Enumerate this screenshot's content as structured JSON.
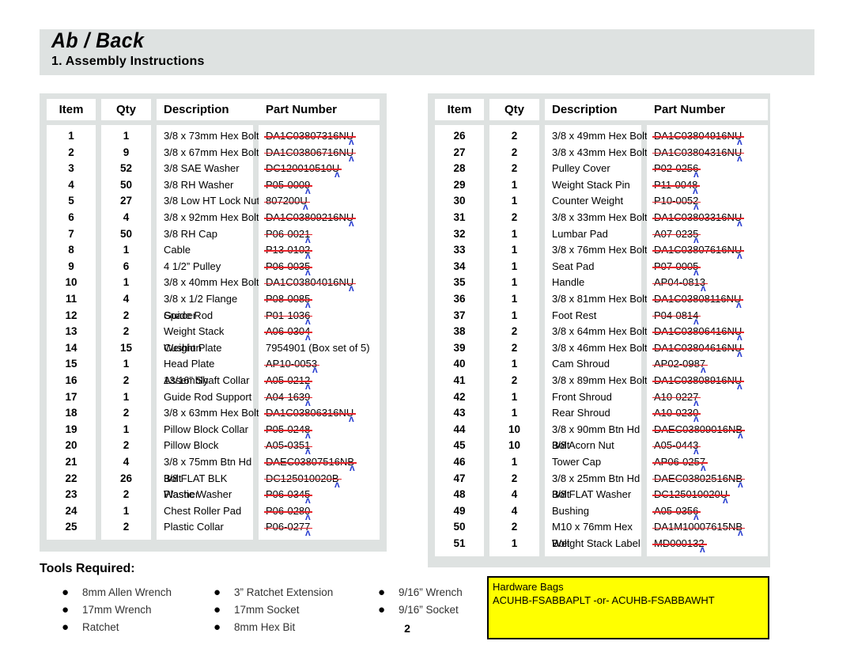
{
  "header": {
    "brand": "Ab / Back",
    "section": "1. Assembly Instructions"
  },
  "table_columns": [
    "Item",
    "Qty",
    "Description",
    "Part Number"
  ],
  "left_table": {
    "columns": [
      "Item",
      "Qty",
      "Description",
      "Part Number"
    ],
    "rows": [
      {
        "item": "1",
        "qty": "1",
        "description": "3/8 x 73mm Hex Bolt",
        "part": "DA1C03807316NU",
        "struck": true
      },
      {
        "item": "2",
        "qty": "9",
        "description": "3/8 x 67mm Hex Bolt",
        "part": "DA1C03806716NU",
        "struck": true
      },
      {
        "item": "3",
        "qty": "52",
        "description": "3/8 SAE Washer",
        "part": "DC120010510U",
        "struck": true
      },
      {
        "item": "4",
        "qty": "50",
        "description": "3/8 RH Washer",
        "part": "P05-0009",
        "struck": true
      },
      {
        "item": "5",
        "qty": "27",
        "description": "3/8 Low HT Lock Nut",
        "part": "807200U",
        "struck": true
      },
      {
        "item": "6",
        "qty": "4",
        "description": "3/8 x 92mm Hex Bolt",
        "part": "DA1C03809216NU",
        "struck": true
      },
      {
        "item": "7",
        "qty": "50",
        "description": "3/8 RH Cap",
        "part": "P06-0021",
        "struck": true
      },
      {
        "item": "8",
        "qty": "1",
        "description": "Cable",
        "part": "P13-0102",
        "struck": true
      },
      {
        "item": "9",
        "qty": "6",
        "description": "4 1/2” Pulley",
        "part": "P06-0035",
        "struck": true
      },
      {
        "item": "10",
        "qty": "1",
        "description": "3/8 x 40mm Hex Bolt",
        "part": "DA1C03804016NU",
        "struck": true
      },
      {
        "item": "11",
        "qty": "4",
        "description": "3/8 x 1/2 Flange Spacer",
        "part": "P08-0085",
        "struck": true
      },
      {
        "item": "12",
        "qty": "2",
        "description": "Guide Rod",
        "part": "P01-1036",
        "struck": true
      },
      {
        "item": "13",
        "qty": "2",
        "description": "Weight Stack Cushion",
        "part": "A06-0304",
        "struck": true
      },
      {
        "item": "14",
        "qty": "15",
        "description": "Weight Plate",
        "part": "7954901 (Box set of 5)",
        "struck": false
      },
      {
        "item": "15",
        "qty": "1",
        "description": "Head Plate Assembly",
        "part": "AP10-0053",
        "struck": true
      },
      {
        "item": "16",
        "qty": "2",
        "description": "13/16” Shaft Collar",
        "part": "A05-0212",
        "struck": true
      },
      {
        "item": "17",
        "qty": "1",
        "description": "Guide Rod Support",
        "part": "A04-1639",
        "struck": true
      },
      {
        "item": "18",
        "qty": "2",
        "description": "3/8 x 63mm Hex Bolt",
        "part": "DA1C03806316NU",
        "struck": true
      },
      {
        "item": "19",
        "qty": "1",
        "description": "Pillow Block Collar",
        "part": "P05-0248",
        "struck": true
      },
      {
        "item": "20",
        "qty": "2",
        "description": "Pillow Block",
        "part": "A05-0351",
        "struck": true
      },
      {
        "item": "21",
        "qty": "4",
        "description": "3/8 x 75mm Btn Hd Bolt",
        "part": "DAEC03807516NB",
        "struck": true
      },
      {
        "item": "22",
        "qty": "26",
        "description": "3/8 FLAT BLK Washer",
        "part": "DC125010020B",
        "struck": true
      },
      {
        "item": "23",
        "qty": "2",
        "description": "Plastic Washer",
        "part": "P06-0345",
        "struck": true
      },
      {
        "item": "24",
        "qty": "1",
        "description": "Chest Roller Pad",
        "part": "P06-0280",
        "struck": true
      },
      {
        "item": "25",
        "qty": "2",
        "description": "Plastic Collar",
        "part": "P06-0277",
        "struck": true
      }
    ]
  },
  "right_table": {
    "columns": [
      "Item",
      "Qty",
      "Description",
      "Part Number"
    ],
    "rows": [
      {
        "item": "26",
        "qty": "2",
        "description": "3/8 x 49mm Hex Bolt",
        "part": "DA1C03804916NU",
        "struck": true
      },
      {
        "item": "27",
        "qty": "2",
        "description": "3/8 x 43mm Hex Bolt",
        "part": "DA1C03804316NU",
        "struck": true
      },
      {
        "item": "28",
        "qty": "2",
        "description": "Pulley Cover",
        "part": "P02-0256",
        "struck": true
      },
      {
        "item": "29",
        "qty": "1",
        "description": "Weight Stack Pin",
        "part": "P11-0048",
        "struck": true
      },
      {
        "item": "30",
        "qty": "1",
        "description": "Counter Weight",
        "part": "P10-0052",
        "struck": true
      },
      {
        "item": "31",
        "qty": "2",
        "description": "3/8 x 33mm Hex Bolt",
        "part": "DA1C03803316NU",
        "struck": true
      },
      {
        "item": "32",
        "qty": "1",
        "description": "Lumbar Pad",
        "part": "A07-0235",
        "struck": true
      },
      {
        "item": "33",
        "qty": "1",
        "description": "3/8 x 76mm Hex Bolt",
        "part": "DA1C03807616NU",
        "struck": true
      },
      {
        "item": "34",
        "qty": "1",
        "description": "Seat Pad",
        "part": "P07-0005",
        "struck": true
      },
      {
        "item": "35",
        "qty": "1",
        "description": "Handle",
        "part": "AP04-0813",
        "struck": true
      },
      {
        "item": "36",
        "qty": "1",
        "description": "3/8 x 81mm Hex Bolt",
        "part": "DA1C03808116NU",
        "struck": true
      },
      {
        "item": "37",
        "qty": "1",
        "description": "Foot Rest",
        "part": "P04-0814",
        "struck": true
      },
      {
        "item": "38",
        "qty": "2",
        "description": "3/8 x 64mm Hex Bolt",
        "part": "DA1C03806416NU",
        "struck": true
      },
      {
        "item": "39",
        "qty": "2",
        "description": "3/8 x 46mm Hex Bolt",
        "part": "DA1C03804616NU",
        "struck": true
      },
      {
        "item": "40",
        "qty": "1",
        "description": "Cam Shroud",
        "part": "AP02-0987",
        "struck": true
      },
      {
        "item": "41",
        "qty": "2",
        "description": "3/8 x 89mm Hex Bolt",
        "part": "DA1C03808916NU",
        "struck": true
      },
      {
        "item": "42",
        "qty": "1",
        "description": "Front Shroud",
        "part": "A10-0227",
        "struck": true
      },
      {
        "item": "43",
        "qty": "1",
        "description": "Rear Shroud",
        "part": "A10-0230",
        "struck": true
      },
      {
        "item": "44",
        "qty": "10",
        "description": "3/8 x 90mm Btn Hd Bolt",
        "part": "DAEC03809016NB",
        "struck": true
      },
      {
        "item": "45",
        "qty": "10",
        "description": "3/8 Acorn Nut",
        "part": "A05-0443",
        "struck": true
      },
      {
        "item": "46",
        "qty": "1",
        "description": "Tower Cap",
        "part": "AP06-0257",
        "struck": true
      },
      {
        "item": "47",
        "qty": "2",
        "description": "3/8 x 25mm Btn Hd Bolt",
        "part": "DAEC03802516NB",
        "struck": true
      },
      {
        "item": "48",
        "qty": "4",
        "description": "3/8 FLAT Washer",
        "part": "DC125010020U",
        "struck": true
      },
      {
        "item": "49",
        "qty": "4",
        "description": "Bushing",
        "part": "A05-0356",
        "struck": true
      },
      {
        "item": "50",
        "qty": "2",
        "description": "M10 x 76mm Hex Bolt",
        "part": "DA1M10007615NB",
        "struck": true
      },
      {
        "item": "51",
        "qty": "1",
        "description": "Weight Stack Label",
        "part": "MD000132",
        "struck": true
      }
    ]
  },
  "tools": {
    "heading": "Tools Required:",
    "bullet_glyph": "●",
    "columns": [
      [
        "8mm Allen Wrench",
        "17mm Wrench",
        "Ratchet"
      ],
      [
        "3” Ratchet Extension",
        "17mm Socket",
        "8mm Hex Bit"
      ],
      [
        "9/16” Wrench",
        "9/16” Socket"
      ]
    ]
  },
  "hardware_bags": {
    "title": "Hardware Bags",
    "codes": "ACUHB-FSABBAPLT -or- ACUHB-FSABBAWHT",
    "background_color": "#ffff00",
    "border_color": "#000000"
  },
  "page_number": "2",
  "colors": {
    "band": "#dee2e1",
    "strike": "#e8232a",
    "caret": "#2a3fd0"
  }
}
